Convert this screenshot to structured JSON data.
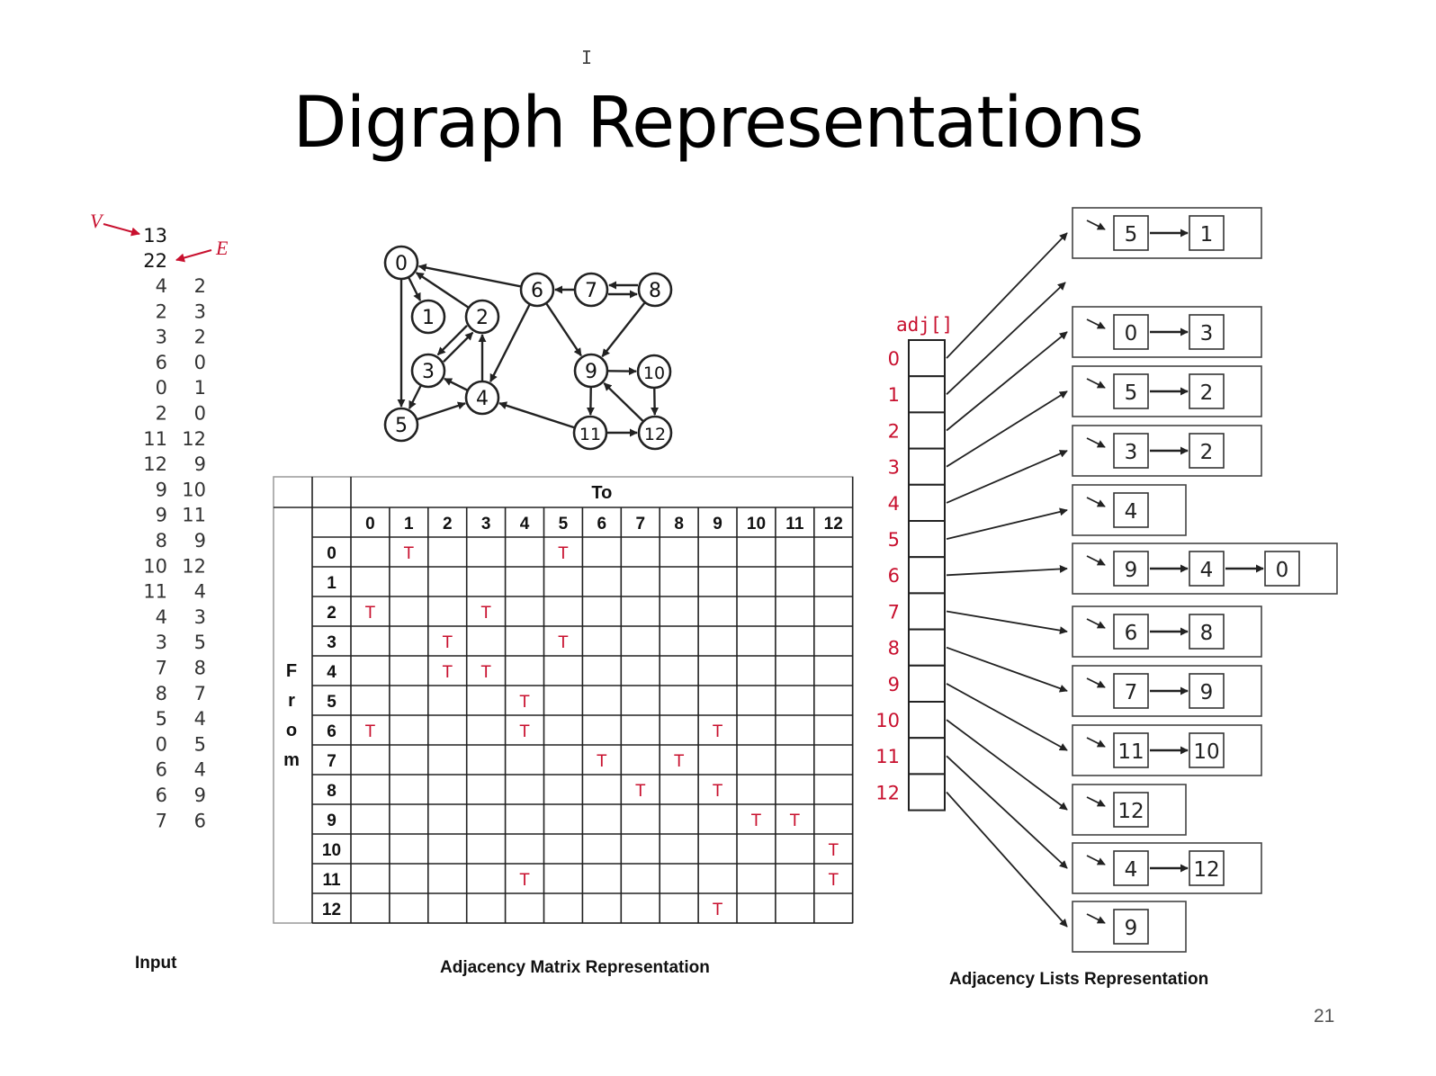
{
  "slide": {
    "title": "Digraph Representations",
    "page_number": "21",
    "cursor_glyph": "I"
  },
  "colors": {
    "accent_red": "#c8102e",
    "ink": "#111111",
    "line": "#222222"
  },
  "input": {
    "v_label": "V",
    "e_label": "E",
    "v_value": "13",
    "e_value": "22",
    "edges": [
      [
        4,
        2
      ],
      [
        2,
        3
      ],
      [
        3,
        2
      ],
      [
        6,
        0
      ],
      [
        0,
        1
      ],
      [
        2,
        0
      ],
      [
        11,
        12
      ],
      [
        12,
        9
      ],
      [
        9,
        10
      ],
      [
        9,
        11
      ],
      [
        8,
        9
      ],
      [
        10,
        12
      ],
      [
        11,
        4
      ],
      [
        4,
        3
      ],
      [
        3,
        5
      ],
      [
        7,
        8
      ],
      [
        8,
        7
      ],
      [
        5,
        4
      ],
      [
        0,
        5
      ],
      [
        6,
        4
      ],
      [
        6,
        9
      ],
      [
        7,
        6
      ]
    ],
    "caption": "Input"
  },
  "graph": {
    "vertices": [
      "0",
      "1",
      "2",
      "3",
      "4",
      "5",
      "6",
      "7",
      "8",
      "9",
      "10",
      "11",
      "12"
    ]
  },
  "matrix": {
    "to_label": "To",
    "from_letters": [
      "F",
      "r",
      "o",
      "m"
    ],
    "headers": [
      "0",
      "1",
      "2",
      "3",
      "4",
      "5",
      "6",
      "7",
      "8",
      "9",
      "10",
      "11",
      "12"
    ],
    "rows": [
      "0",
      "1",
      "2",
      "3",
      "4",
      "5",
      "6",
      "7",
      "8",
      "9",
      "10",
      "11",
      "12"
    ],
    "true_symbol": "T",
    "true_cells": [
      [
        0,
        1
      ],
      [
        0,
        5
      ],
      [
        2,
        0
      ],
      [
        2,
        3
      ],
      [
        3,
        2
      ],
      [
        3,
        5
      ],
      [
        4,
        2
      ],
      [
        4,
        3
      ],
      [
        5,
        4
      ],
      [
        6,
        0
      ],
      [
        6,
        4
      ],
      [
        6,
        9
      ],
      [
        7,
        6
      ],
      [
        7,
        8
      ],
      [
        8,
        7
      ],
      [
        8,
        9
      ],
      [
        9,
        10
      ],
      [
        9,
        11
      ],
      [
        10,
        12
      ],
      [
        11,
        4
      ],
      [
        11,
        12
      ],
      [
        12,
        9
      ]
    ],
    "caption": "Adjacency Matrix Representation"
  },
  "lists": {
    "array_label": "adj[]",
    "indices": [
      "0",
      "1",
      "2",
      "3",
      "4",
      "5",
      "6",
      "7",
      "8",
      "9",
      "10",
      "11",
      "12"
    ],
    "entries": [
      [
        "5",
        "1"
      ],
      [],
      [
        "0",
        "3"
      ],
      [
        "5",
        "2"
      ],
      [
        "3",
        "2"
      ],
      [
        "4"
      ],
      [
        "9",
        "4",
        "0"
      ],
      [
        "6",
        "8"
      ],
      [
        "7",
        "9"
      ],
      [
        "11",
        "10"
      ],
      [
        "12"
      ],
      [
        "4",
        "12"
      ],
      [
        "9"
      ]
    ],
    "caption": "Adjacency Lists Representation"
  }
}
